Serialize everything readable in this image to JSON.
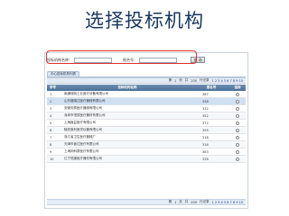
{
  "slide": {
    "title": "选择投标机构"
  },
  "search": {
    "name_label": "投标机构名称：",
    "code_label": "报名号：",
    "button_label": "查 询"
  },
  "tabs": [
    {
      "label": "中心投标机构列表"
    }
  ],
  "pagination": {
    "page_text": "第",
    "page_value": "1",
    "page_unit": "页",
    "total_text": "共",
    "total_value": "200",
    "record_text": "行记录",
    "page_links": "1 2 3 4 5 6 7 8 9 10"
  },
  "table": {
    "headers": {
      "no": "序号",
      "name": "投标机构名称",
      "code": "报名号",
      "select": "选择"
    },
    "rows": [
      {
        "no": "1",
        "name": "南通瑞特工业医疗设备有限公司",
        "code": "387"
      },
      {
        "no": "2",
        "name": "山东福瑞达医疗器械有限公司",
        "code": "338"
      },
      {
        "no": "3",
        "name": "安徽安泰医疗器械有限公司",
        "code": "332"
      },
      {
        "no": "4",
        "name": "深圳市恒辰医疗器材有限公司",
        "code": "352"
      },
      {
        "no": "5",
        "name": "上海鑫益医疗有限公司",
        "code": "372"
      },
      {
        "no": "6",
        "name": "陕西惠利医学仪器有限公司",
        "code": "395"
      },
      {
        "no": "7",
        "name": "浙江省卫生医疗器械厂",
        "code": "318"
      },
      {
        "no": "8",
        "name": "天津市鑫达医疗有限公司",
        "code": "316"
      },
      {
        "no": "9",
        "name": "上海闵科泰医疗有限公司",
        "code": "383"
      },
      {
        "no": "10",
        "name": "辽宁恒康医疗器材有限公司",
        "code": "328"
      }
    ]
  }
}
